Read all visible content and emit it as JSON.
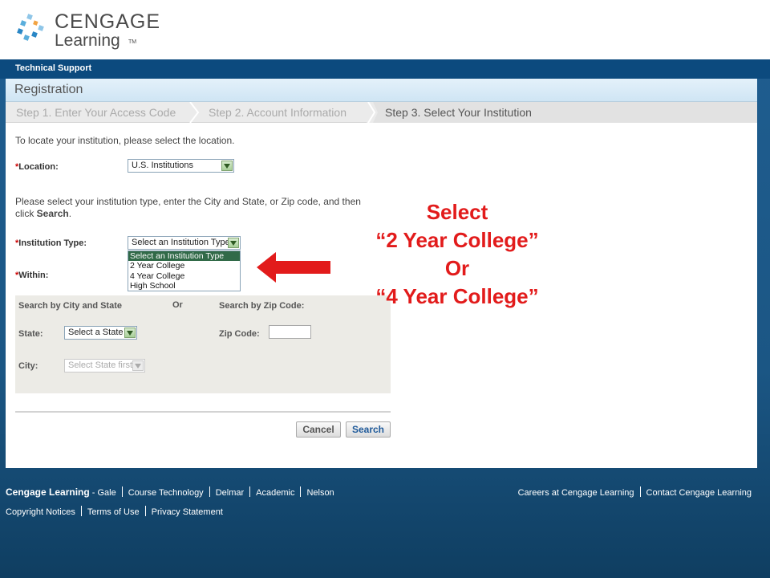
{
  "header": {
    "logo_line1": "CENGAGE",
    "logo_line2": "Learning",
    "logo_tm": "TM"
  },
  "topbar": {
    "label": "Technical Support"
  },
  "registration": {
    "title": "Registration"
  },
  "steps": [
    {
      "label": "Step 1.  Enter Your Access Code",
      "state": "done"
    },
    {
      "label": "Step 2. Account Information",
      "state": "done"
    },
    {
      "label": "Step 3. Select Your Institution",
      "state": "current"
    }
  ],
  "form": {
    "intro_text": "To locate your institution, please select the location.",
    "location_label": "Location:",
    "location_value": "U.S. Institutions",
    "instructions_line1": "Please select your institution type, enter the City and State, or Zip code, and then",
    "instructions_line2_prefix": "click ",
    "instructions_line2_bold": "Search",
    "instructions_line2_suffix": ".",
    "institution_type_label": "Institution Type:",
    "institution_type_value": "Select an Institution Type",
    "institution_type_options": [
      "Select an Institution Type",
      "2 Year College",
      "4 Year College",
      "High School"
    ],
    "within_label": "Within:",
    "required_mark": "*"
  },
  "search_box": {
    "city_state_heading": "Search by City and State",
    "or_text": "Or",
    "zip_heading": "Search by Zip Code:",
    "state_label": "State:",
    "state_value": "Select a State",
    "zip_label": "Zip Code:",
    "zip_value": "",
    "city_label": "City:",
    "city_value": "Select State first"
  },
  "buttons": {
    "cancel": "Cancel",
    "search": "Search"
  },
  "annotation": {
    "line1": "Select",
    "line2": "“2 Year College”",
    "line3": "Or",
    "line4": "“4 Year College”",
    "color": "#e21b1b"
  },
  "footer": {
    "brand": "Cengage Learning",
    "brand_sep": " - ",
    "links": [
      "Gale",
      "Course Technology",
      "Delmar",
      "Academic",
      "Nelson"
    ],
    "right_links": [
      "Careers at Cengage Learning",
      "Contact Cengage Learning"
    ],
    "bottom_links": [
      "Copyright Notices",
      "Terms of Use",
      "Privacy Statement"
    ]
  },
  "colors": {
    "topbar": "#0c4a7e",
    "background": "#1f5d8f",
    "accent_link": "#1f5a9a",
    "selected_option": "#316a48"
  }
}
